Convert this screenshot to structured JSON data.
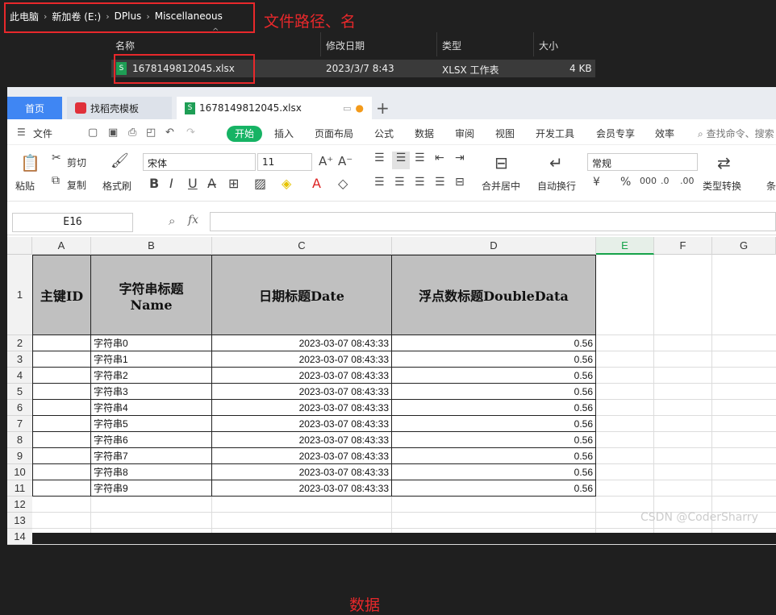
{
  "explorer": {
    "breadcrumb": [
      "此电脑",
      "新加卷 (E:)",
      "DPlus",
      "Miscellaneous"
    ],
    "annotation": "文件路径、名",
    "columns": {
      "name": "名称",
      "date": "修改日期",
      "type": "类型",
      "size": "大小"
    },
    "file": {
      "name": "1678149812045.xlsx",
      "date": "2023/3/7 8:43",
      "type": "XLSX 工作表",
      "size": "4 KB"
    }
  },
  "app": {
    "tabs": {
      "home": "首页",
      "templates": "找稻壳模板",
      "file": "1678149812045.xlsx"
    },
    "menu": {
      "file": "文件",
      "start": "开始",
      "insert": "插入",
      "layout": "页面布局",
      "formula": "公式",
      "data": "数据",
      "review": "审阅",
      "view": "视图",
      "dev": "开发工具",
      "member": "会员专享",
      "efficiency": "效率",
      "search": "查找命令、搜索"
    },
    "toolbar": {
      "paste": "粘贴",
      "cut": "剪切",
      "copy": "复制",
      "format_painter": "格式刷",
      "font": "宋体",
      "font_size": "11",
      "merge": "合并居中",
      "wrap": "自动换行",
      "number_format": "常规",
      "type_convert": "类型转换",
      "cond": "条"
    },
    "namebox": "E16",
    "fx": "fx",
    "columns": [
      "A",
      "B",
      "C",
      "D",
      "E",
      "F",
      "G"
    ],
    "rows": [
      "1",
      "2",
      "3",
      "4",
      "5",
      "6",
      "7",
      "8",
      "9",
      "10",
      "11",
      "12",
      "13",
      "14"
    ],
    "headers": {
      "a": "主键ID",
      "b": "字符串标题Name",
      "c": "日期标题Date",
      "d": "浮点数标题DoubleData"
    },
    "data": [
      [
        "字符串0",
        "2023-03-07 08:43:33",
        "0.56"
      ],
      [
        "字符串1",
        "2023-03-07 08:43:33",
        "0.56"
      ],
      [
        "字符串2",
        "2023-03-07 08:43:33",
        "0.56"
      ],
      [
        "字符串3",
        "2023-03-07 08:43:33",
        "0.56"
      ],
      [
        "字符串4",
        "2023-03-07 08:43:33",
        "0.56"
      ],
      [
        "字符串5",
        "2023-03-07 08:43:33",
        "0.56"
      ],
      [
        "字符串6",
        "2023-03-07 08:43:33",
        "0.56"
      ],
      [
        "字符串7",
        "2023-03-07 08:43:33",
        "0.56"
      ],
      [
        "字符串8",
        "2023-03-07 08:43:33",
        "0.56"
      ],
      [
        "字符串9",
        "2023-03-07 08:43:33",
        "0.56"
      ]
    ],
    "annotation": "数据",
    "watermark": "CSDN @CoderSharry",
    "colors": {
      "active_tab": "#3f86f3",
      "start_button": "#16b364",
      "annotation": "#e8282b",
      "header_fill": "#c0c0c0"
    }
  }
}
